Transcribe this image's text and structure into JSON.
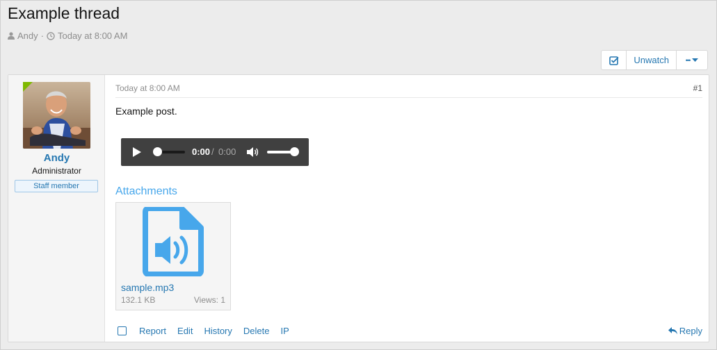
{
  "thread": {
    "title": "Example thread",
    "author": "Andy",
    "separator": "·",
    "date": "Today at 8:00 AM"
  },
  "toolbar": {
    "unwatch_label": "Unwatch",
    "more_label": "•••"
  },
  "post": {
    "user": {
      "name": "Andy",
      "title": "Administrator",
      "badge": "Staff member"
    },
    "date": "Today at 8:00 AM",
    "number": "#1",
    "body": "Example post.",
    "audio": {
      "current_time": "0:00",
      "separator": "/",
      "duration": "0:00"
    },
    "attachments_heading": "Attachments",
    "attachment": {
      "name": "sample.mp3",
      "size": "132.1 KB",
      "views": "Views: 1",
      "icon": "file-audio-icon"
    },
    "actions": [
      "Report",
      "Edit",
      "History",
      "Delete",
      "IP"
    ],
    "reply_label": "Reply"
  },
  "colors": {
    "link": "#2577b1",
    "accent": "#47a7eb",
    "online": "#7fb900"
  }
}
